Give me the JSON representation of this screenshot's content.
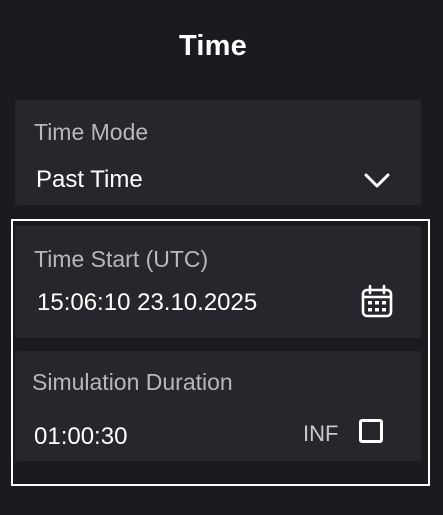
{
  "panel": {
    "title": "Time"
  },
  "time_mode": {
    "label": "Time Mode",
    "selected": "Past Time",
    "icon": "chevron-down-icon"
  },
  "time_start": {
    "label": "Time Start (UTC)",
    "value": "15:06:10 23.10.2025",
    "icon": "calendar-icon"
  },
  "simulation_duration": {
    "label": "Simulation Duration",
    "value": "01:00:30",
    "inf_label": "INF",
    "inf_checked": false
  },
  "colors": {
    "background": "#1a1b1f",
    "card": "#26272c",
    "label": "#b7b8bd",
    "text": "#ffffff",
    "group_border": "#ffffff"
  }
}
